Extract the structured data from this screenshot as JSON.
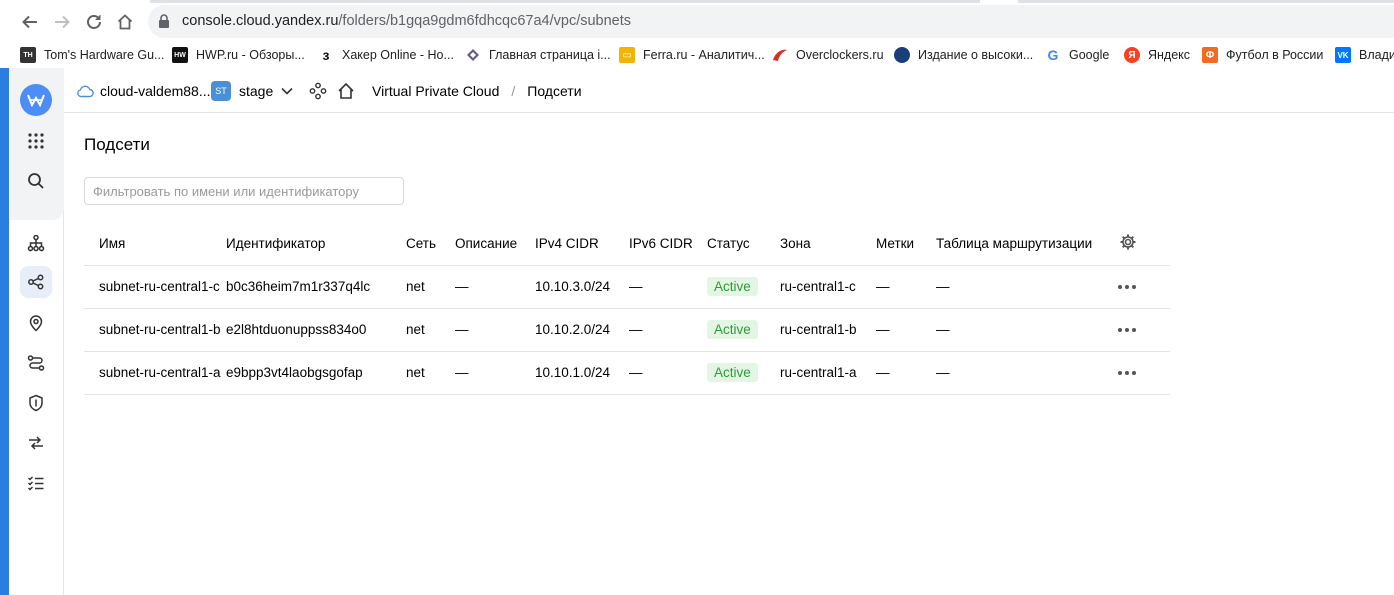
{
  "browser": {
    "url_host": "console.cloud.yandex.ru",
    "url_path": "/folders/b1gqa9gdm6fdhcqc67a4/vpc/subnets",
    "bookmarks": [
      {
        "label": "Tom's Hardware Gu...",
        "icon": "toms-hardware-icon",
        "color": "#333333"
      },
      {
        "label": "HWP.ru - Обзоры...",
        "icon": "hwp-icon",
        "color": "#111111"
      },
      {
        "label": "Хакер Online - Но...",
        "icon": "xakep-icon",
        "color": "#111111"
      },
      {
        "label": "Главная страница i...",
        "icon": "diamond-icon",
        "color": "#6a5a8a"
      },
      {
        "label": "Ferra.ru - Аналитич...",
        "icon": "ferra-icon",
        "color": "#f2b400"
      },
      {
        "label": "Overclockers.ru",
        "icon": "overclockers-icon",
        "color": "#d32f2f"
      },
      {
        "label": "Издание о высоки...",
        "icon": "globe-icon",
        "color": "#1a3d7c"
      },
      {
        "label": "Google",
        "icon": "google-icon",
        "color": "#4285f4"
      },
      {
        "label": "Яндекс",
        "icon": "yandex-icon",
        "color": "#fc3f1d"
      },
      {
        "label": "Футбол в России",
        "icon": "football-icon",
        "color": "#f26b21"
      },
      {
        "label": "Влади",
        "icon": "vk-icon",
        "color": "#0077ff"
      }
    ]
  },
  "header": {
    "cloud": "cloud-valdem88...",
    "folder_badge": "ST",
    "folder": "stage",
    "breadcrumb_service": "Virtual Private Cloud",
    "breadcrumb_sep": "/",
    "breadcrumb_page": "Подсети"
  },
  "main": {
    "title": "Подсети",
    "filter_placeholder": "Фильтровать по имени или идентификатору",
    "columns": [
      "Имя",
      "Идентификатор",
      "Сеть",
      "Описание",
      "IPv4 CIDR",
      "IPv6 CIDR",
      "Статус",
      "Зона",
      "Метки",
      "Таблица маршрутизации"
    ],
    "rows": [
      {
        "name": "subnet-ru-central1-c",
        "id": "b0c36heim7m1r337q4lc",
        "network": "net",
        "description": "—",
        "ipv4": "10.10.3.0/24",
        "ipv6": "—",
        "status": "Active",
        "zone": "ru-central1-c",
        "labels": "—",
        "route_table": "—"
      },
      {
        "name": "subnet-ru-central1-b",
        "id": "e2l8htduonuppss834o0",
        "network": "net",
        "description": "—",
        "ipv4": "10.10.2.0/24",
        "ipv6": "—",
        "status": "Active",
        "zone": "ru-central1-b",
        "labels": "—",
        "route_table": "—"
      },
      {
        "name": "subnet-ru-central1-a",
        "id": "e9bpp3vt4laobgsgofap",
        "network": "net",
        "description": "—",
        "ipv4": "10.10.1.0/24",
        "ipv6": "—",
        "status": "Active",
        "zone": "ru-central1-a",
        "labels": "—",
        "route_table": "—"
      }
    ]
  },
  "colors": {
    "accent": "#2d5ebf",
    "status_active_bg": "#e3f5e3",
    "status_active_fg": "#2f9a3a",
    "logo": "#4c8df6"
  }
}
